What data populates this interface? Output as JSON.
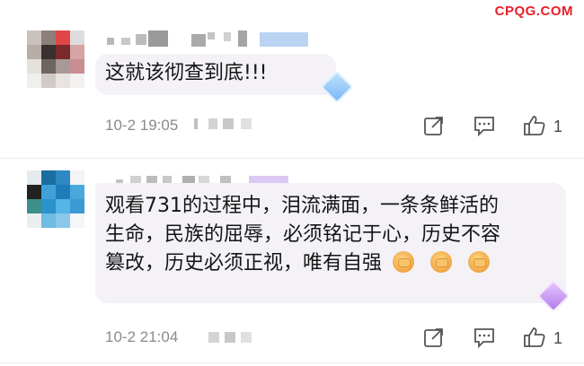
{
  "watermark": "CPQG.COM",
  "comments": [
    {
      "text_lines": [
        "这就该彻查到底!!!"
      ],
      "time": "10-2 19:05",
      "like_count": "1"
    },
    {
      "text_lines": [
        "观看731的过程中，泪流满面，一条条鲜活的",
        "生命，民族的屈辱，必须铭记于心，历史不容",
        "篡改，历史必须正视，唯有自强"
      ],
      "time": "10-2 21:04",
      "like_count": "1"
    }
  ],
  "icons": {
    "share": "share-icon",
    "reply": "comment-icon",
    "like": "thumbs-up-icon",
    "emoji": "fist-emoji-icon",
    "badge": "diamond-badge-icon"
  },
  "colors": {
    "watermark": "#e8202a",
    "bubble": "#f4f2f7",
    "meta_text": "#8a8a8a"
  }
}
